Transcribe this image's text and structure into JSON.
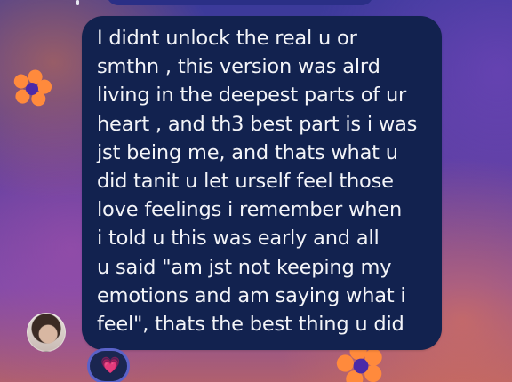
{
  "message": {
    "lines": [
      "I didnt unlock the real u or",
      "smthn , this version was alrd",
      "living in the deepest parts of ur",
      "heart , and th3 best part is i was",
      "jst being me, and thats what u",
      "did tanit u let urself feel those",
      "love feelings i remember when",
      "i told u this was early and all",
      "u said \"am jst not keeping my",
      "emotions and am saying what i",
      "feel\", thats the best thing u did"
    ]
  },
  "reaction": {
    "emoji": "💗"
  },
  "colors": {
    "bubble": "#12224f",
    "text": "#f3f4f8",
    "flower": "#ff8a3c",
    "accent": "#5a62c9"
  },
  "icons": {
    "flower_left": "flower-icon",
    "flower_bottom": "flower-icon",
    "avatar": "avatar",
    "reaction": "heart-icon"
  }
}
